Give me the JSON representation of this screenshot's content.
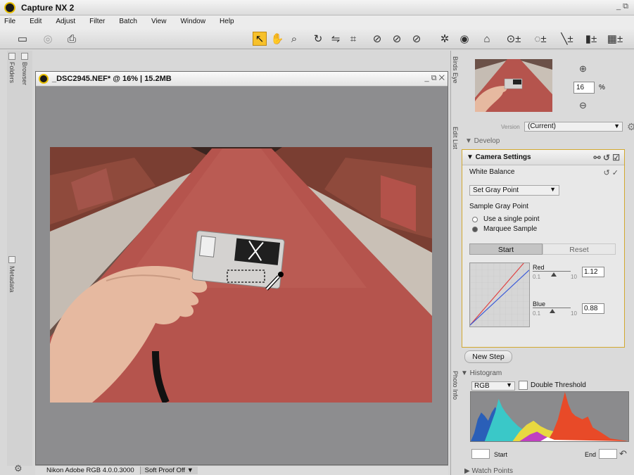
{
  "app": {
    "title": "Capture NX 2",
    "window_controls": "_ ⧉"
  },
  "menu": [
    "File",
    "Edit",
    "Adjust",
    "Filter",
    "Batch",
    "View",
    "Window",
    "Help"
  ],
  "toolbar": {
    "icons": [
      "view-mode-icon",
      "camera-icon",
      "print-icon",
      "select-arrow-icon",
      "hand-icon",
      "zoom-icon",
      "rotate-icon",
      "straighten-icon",
      "crop-icon",
      "black-point-icon",
      "neutral-point-icon",
      "white-point-icon",
      "color-control-point-icon",
      "red-eye-icon",
      "auto-retouch-icon",
      "selection-brush-icon",
      "lasso-icon",
      "gradient-icon",
      "fill-icon"
    ]
  },
  "left_panes": {
    "folders": "Folders",
    "browser": "Browser",
    "metadata": "Metadata"
  },
  "document": {
    "title": "_DSC2945.NEF* @ 16% | 15.2MB",
    "window_controls": "_ ⧉ ✕"
  },
  "status": {
    "profile": "Nikon Adobe RGB 4.0.0.3000",
    "soft_proof": "Soft Proof Off ▼"
  },
  "birds_eye": {
    "label": "Birds Eye",
    "zoom_value": "16",
    "zoom_unit": "%"
  },
  "edit_list": {
    "label": "Edit List",
    "version_label": "Version",
    "version_value": "(Current)",
    "develop": "▼ Develop",
    "camera_settings": "▼ Camera Settings",
    "white_balance": "White Balance",
    "gray_point_select": "Set Gray Point",
    "sample_gray_point": "Sample Gray Point",
    "radio_single": "Use a single point",
    "radio_marquee": "Marquee Sample",
    "marquee_selected": true,
    "tab_start": "Start",
    "tab_reset": "Reset",
    "red": {
      "name": "Red",
      "min": "0.1",
      "max": "10",
      "value": "1.12"
    },
    "blue": {
      "name": "Blue",
      "min": "0.1",
      "max": "10",
      "value": "0.88"
    },
    "new_step": "New Step"
  },
  "photo_info": {
    "label": "Photo Info",
    "histogram": "▼ Histogram",
    "channel": "RGB",
    "double_threshold": "Double Threshold",
    "start_label": "Start",
    "end_label": "End",
    "watch_points": "▶ Watch Points"
  },
  "colors": {
    "accent": "#f7c12b",
    "panel_border": "#d2a82e",
    "canvas_bg": "#8d8d8f",
    "carpet": "#b5544d"
  }
}
